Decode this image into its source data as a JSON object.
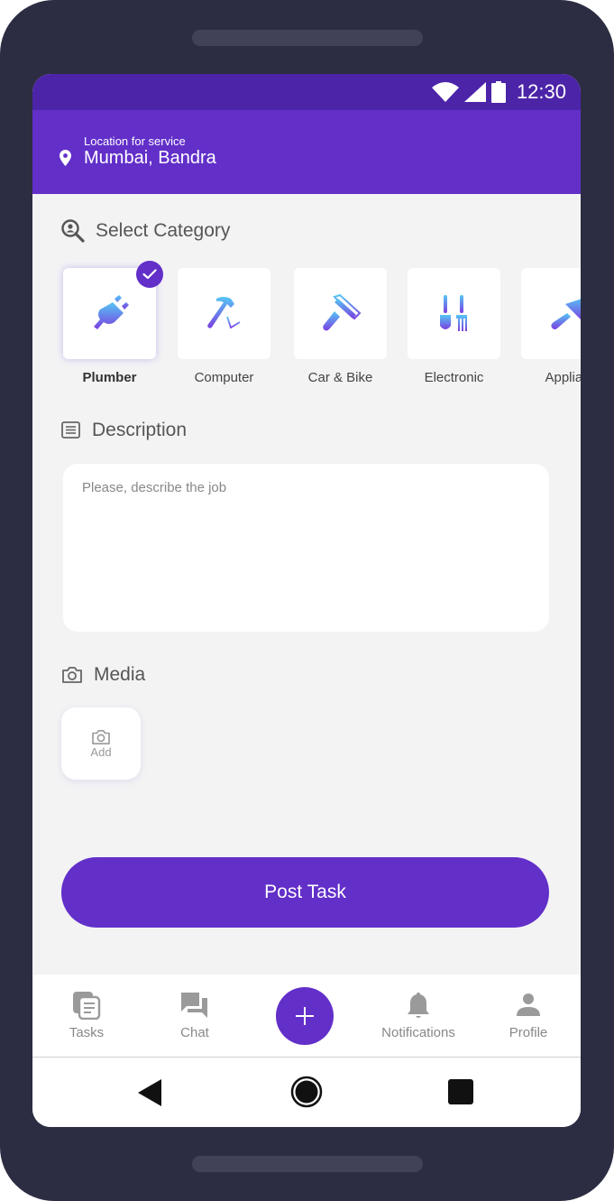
{
  "status_bar": {
    "time": "12:30",
    "icons": [
      "wifi-icon",
      "signal-icon",
      "battery-icon"
    ]
  },
  "header": {
    "location_label": "Location for service",
    "location_value": "Mumbai, Bandra",
    "icon": "map-pin-icon"
  },
  "category_section": {
    "title": "Select Category",
    "icon": "search-person-icon",
    "items": [
      {
        "label": "Plumber",
        "icon": "plug-icon",
        "selected": true
      },
      {
        "label": "Computer",
        "icon": "hammer-icon",
        "selected": false
      },
      {
        "label": "Car & Bike",
        "icon": "paint-roller-icon",
        "selected": false
      },
      {
        "label": "Electronic",
        "icon": "garden-tools-icon",
        "selected": false
      },
      {
        "label": "Applian",
        "icon": "trowel-icon",
        "selected": false
      }
    ]
  },
  "description_section": {
    "title": "Description",
    "icon": "document-icon",
    "placeholder": "Please, describe the job",
    "value": ""
  },
  "media_section": {
    "title": "Media",
    "icon": "camera-icon",
    "add_label": "Add"
  },
  "post_button": {
    "label": "Post Task"
  },
  "bottom_nav": {
    "items": [
      {
        "label": "Tasks",
        "icon": "tasks-icon"
      },
      {
        "label": "Chat",
        "icon": "chat-icon"
      },
      {
        "label": "",
        "icon": "plus-icon"
      },
      {
        "label": "Notifications",
        "icon": "bell-icon"
      },
      {
        "label": "Profile",
        "icon": "person-icon"
      }
    ]
  },
  "system_nav": {
    "buttons": [
      "back-icon",
      "home-icon",
      "recents-icon"
    ]
  },
  "colors": {
    "primary": "#622fc9",
    "status_bar": "#4c24a8",
    "background": "#f3f3f4",
    "device_frame": "#2c2d42"
  }
}
